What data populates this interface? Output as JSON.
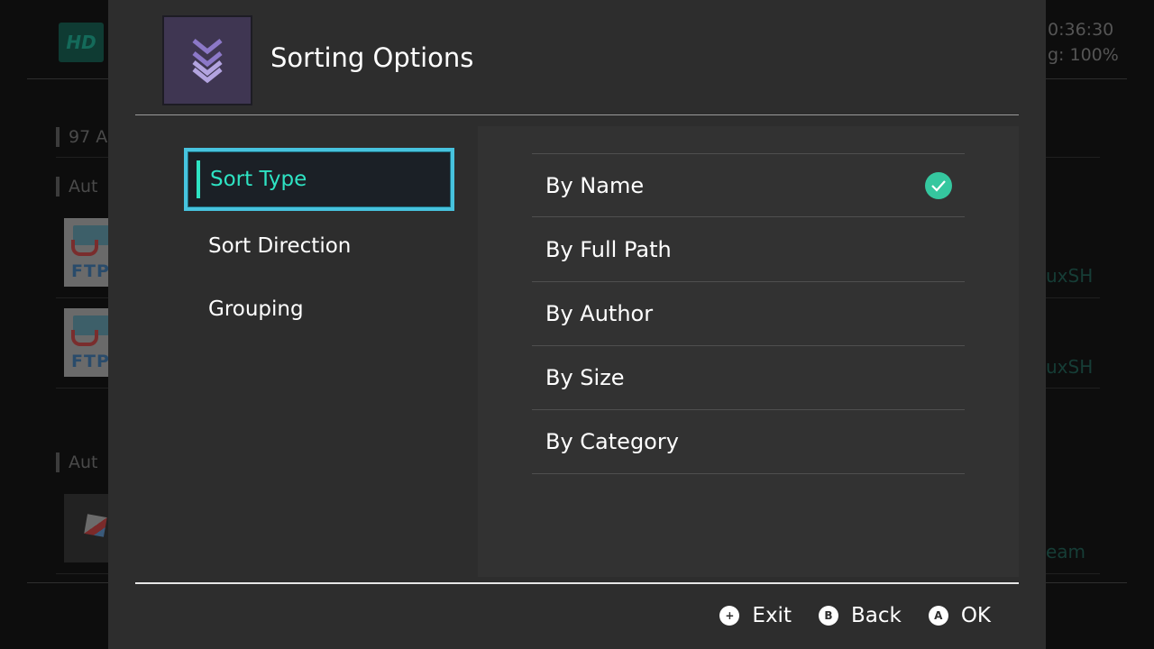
{
  "background": {
    "logo_text": "HD",
    "clock": "0:36:30",
    "battery": "g: 100%",
    "section_headers": [
      "97 A",
      "Aut",
      "Aut"
    ],
    "thumb_label": "FTP",
    "right_texts": [
      "uxSH",
      "uxSH",
      "eam"
    ]
  },
  "dialog": {
    "title": "Sorting Options",
    "icon": "double-chevron-down-icon",
    "sidebar": {
      "items": [
        {
          "label": "Sort Type",
          "selected": true
        },
        {
          "label": "Sort Direction",
          "selected": false
        },
        {
          "label": "Grouping",
          "selected": false
        }
      ]
    },
    "options": [
      {
        "label": "By Name",
        "checked": true
      },
      {
        "label": "By Full Path",
        "checked": false
      },
      {
        "label": "By Author",
        "checked": false
      },
      {
        "label": "By Size",
        "checked": false
      },
      {
        "label": "By Category",
        "checked": false
      }
    ]
  },
  "footer": {
    "hints": [
      {
        "button": "+",
        "label": "Exit"
      },
      {
        "button": "B",
        "label": "Back"
      },
      {
        "button": "A",
        "label": "OK"
      }
    ]
  },
  "colors": {
    "accent_text": "#2ee3c3",
    "selection_border": "#47c3de",
    "check": "#35c79f",
    "icon_bg": "#3f3652",
    "icon_fg": "#8c78c8"
  }
}
